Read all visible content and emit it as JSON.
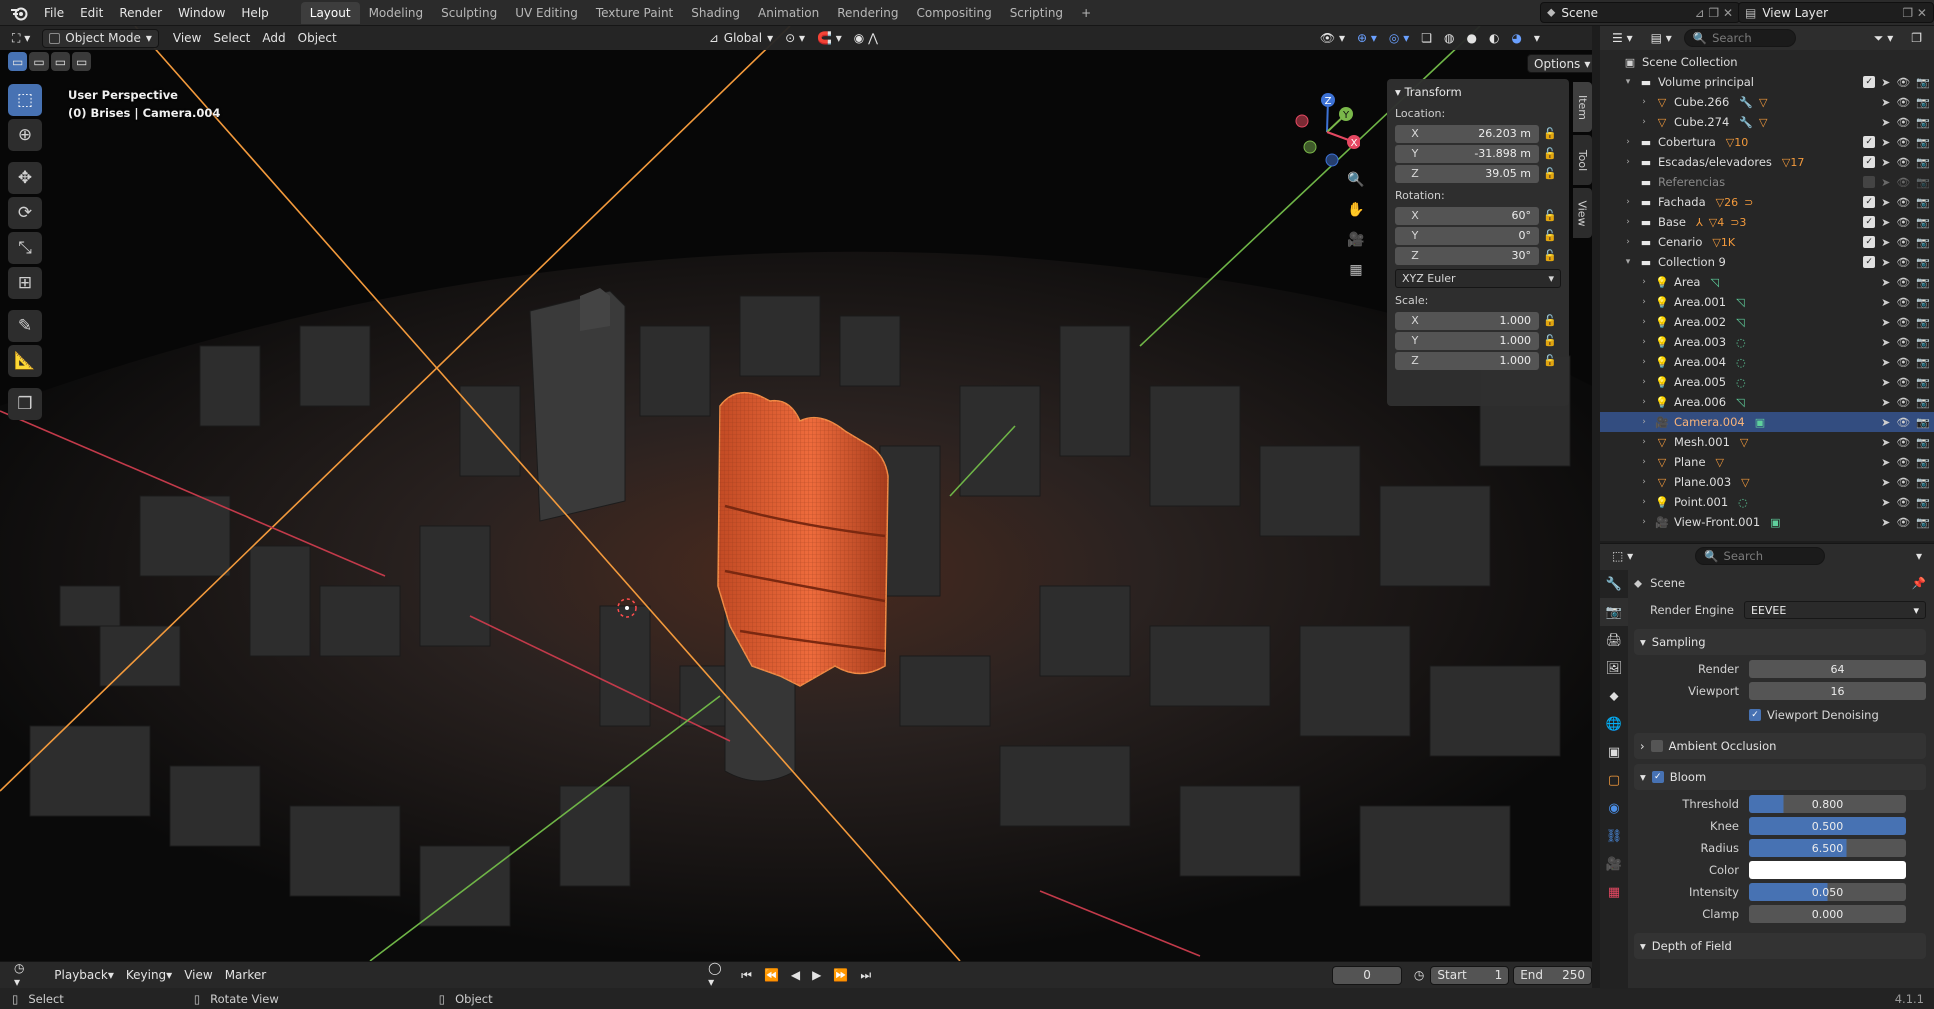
{
  "topbar": {
    "menus": [
      "File",
      "Edit",
      "Render",
      "Window",
      "Help"
    ],
    "workspaces": [
      "Layout",
      "Modeling",
      "Sculpting",
      "UV Editing",
      "Texture Paint",
      "Shading",
      "Animation",
      "Rendering",
      "Compositing",
      "Scripting"
    ],
    "add_tab": "+",
    "scene": "Scene",
    "view_layer": "View Layer"
  },
  "viewport": {
    "mode": "Object Mode",
    "menus": [
      "View",
      "Select",
      "Add",
      "Object"
    ],
    "orientation": "Global",
    "options": "Options",
    "info_line1": "User Perspective",
    "info_line2": "(0) Brises | Camera.004"
  },
  "npanel": {
    "title": "Transform",
    "location_label": "Location:",
    "location": [
      {
        "axis": "X",
        "value": "26.203 m"
      },
      {
        "axis": "Y",
        "value": "-31.898 m"
      },
      {
        "axis": "Z",
        "value": "39.05 m"
      }
    ],
    "rotation_label": "Rotation:",
    "rotation": [
      {
        "axis": "X",
        "value": "60°"
      },
      {
        "axis": "Y",
        "value": "0°"
      },
      {
        "axis": "Z",
        "value": "30°"
      }
    ],
    "rotation_mode": "XYZ Euler",
    "scale_label": "Scale:",
    "scale": [
      {
        "axis": "X",
        "value": "1.000"
      },
      {
        "axis": "Y",
        "value": "1.000"
      },
      {
        "axis": "Z",
        "value": "1.000"
      }
    ],
    "tabs": [
      "Item",
      "Tool",
      "View"
    ]
  },
  "gizmo": {
    "x": "X",
    "y": "Y",
    "z": "Z"
  },
  "timeline": {
    "menus": [
      "Playback",
      "Keying",
      "View",
      "Marker"
    ],
    "current_frame": "0",
    "start_label": "Start",
    "start": "1",
    "end_label": "End",
    "end": "250"
  },
  "status": {
    "select": "Select",
    "rotate": "Rotate View",
    "object": "Object",
    "version": "4.1.1"
  },
  "outliner": {
    "search_placeholder": "Search",
    "rows": [
      {
        "name": "Scene Collection",
        "depth": 0,
        "type": "scene",
        "arrow": ""
      },
      {
        "name": "Volume principal",
        "depth": 1,
        "type": "collection",
        "arrow": "▾",
        "check": true
      },
      {
        "name": "Cube.266",
        "depth": 2,
        "type": "mesh",
        "arrow": "›",
        "badges": [
          "🔧",
          "▽"
        ]
      },
      {
        "name": "Cube.274",
        "depth": 2,
        "type": "mesh",
        "arrow": "›",
        "badges": [
          "🔧",
          "▽"
        ]
      },
      {
        "name": "Cobertura",
        "depth": 1,
        "type": "collection",
        "arrow": "›",
        "check": true,
        "badges": [
          "▽10"
        ]
      },
      {
        "name": "Escadas/elevadores",
        "depth": 1,
        "type": "collection",
        "arrow": "›",
        "check": true,
        "badges": [
          "▽17"
        ]
      },
      {
        "name": "Referencias",
        "depth": 1,
        "type": "collection",
        "arrow": "",
        "check": false,
        "dim": true
      },
      {
        "name": "Fachada",
        "depth": 1,
        "type": "collection",
        "arrow": "›",
        "check": true,
        "badges": [
          "▽26",
          "⊃"
        ]
      },
      {
        "name": "Base",
        "depth": 1,
        "type": "collection",
        "arrow": "›",
        "check": true,
        "badges": [
          "⅄",
          "▽4",
          "⊃3"
        ]
      },
      {
        "name": "Cenario",
        "depth": 1,
        "type": "collection",
        "arrow": "›",
        "check": true,
        "badges": [
          "▽1K"
        ]
      },
      {
        "name": "Collection 9",
        "depth": 1,
        "type": "collection",
        "arrow": "▾",
        "check": true
      },
      {
        "name": "Area",
        "depth": 2,
        "type": "light",
        "arrow": "›",
        "badges": [
          "◹"
        ]
      },
      {
        "name": "Area.001",
        "depth": 2,
        "type": "light",
        "arrow": "›",
        "badges": [
          "◹"
        ]
      },
      {
        "name": "Area.002",
        "depth": 2,
        "type": "light",
        "arrow": "›",
        "badges": [
          "◹"
        ]
      },
      {
        "name": "Area.003",
        "depth": 2,
        "type": "light",
        "arrow": "›",
        "badges": [
          "◌"
        ]
      },
      {
        "name": "Area.004",
        "depth": 2,
        "type": "light",
        "arrow": "›",
        "badges": [
          "◌"
        ]
      },
      {
        "name": "Area.005",
        "depth": 2,
        "type": "light",
        "arrow": "›",
        "badges": [
          "◌"
        ]
      },
      {
        "name": "Area.006",
        "depth": 2,
        "type": "light",
        "arrow": "›",
        "badges": [
          "◹"
        ]
      },
      {
        "name": "Camera.004",
        "depth": 2,
        "type": "camera",
        "arrow": "›",
        "selected": true,
        "badges": [
          "▣"
        ]
      },
      {
        "name": "Mesh.001",
        "depth": 2,
        "type": "mesh",
        "arrow": "›",
        "badges": [
          "▽"
        ]
      },
      {
        "name": "Plane",
        "depth": 2,
        "type": "mesh",
        "arrow": "›",
        "badges": [
          "▽"
        ]
      },
      {
        "name": "Plane.003",
        "depth": 2,
        "type": "mesh",
        "arrow": "›",
        "badges": [
          "▽"
        ]
      },
      {
        "name": "Point.001",
        "depth": 2,
        "type": "light",
        "arrow": "›",
        "badges": [
          "◌"
        ]
      },
      {
        "name": "View-Front.001",
        "depth": 2,
        "type": "camera",
        "arrow": "›",
        "badges": [
          "▣"
        ]
      }
    ]
  },
  "properties": {
    "search_placeholder": "Search",
    "context": "Scene",
    "render_engine_label": "Render Engine",
    "render_engine": "EEVEE",
    "sampling": {
      "title": "Sampling",
      "render_label": "Render",
      "render": "64",
      "viewport_label": "Viewport",
      "viewport": "16",
      "denoise": "Viewport Denoising"
    },
    "ao": {
      "title": "Ambient Occlusion"
    },
    "bloom": {
      "title": "Bloom",
      "threshold_label": "Threshold",
      "threshold": "0.800",
      "threshold_fill": 0.22,
      "knee_label": "Knee",
      "knee": "0.500",
      "knee_fill": 1.0,
      "radius_label": "Radius",
      "radius": "6.500",
      "radius_fill": 0.62,
      "color_label": "Color",
      "intensity_label": "Intensity",
      "intensity": "0.050",
      "intensity_fill": 0.5,
      "clamp_label": "Clamp",
      "clamp": "0.000",
      "clamp_fill": 0.0
    },
    "dof": {
      "title": "Depth of Field"
    }
  },
  "colors": {
    "accent": "#4772b3",
    "selected": "#f28c46",
    "building": "#e0623a",
    "xaxis": "#e54862",
    "yaxis": "#7ab84a",
    "camera_frame": "#f39a3c"
  }
}
